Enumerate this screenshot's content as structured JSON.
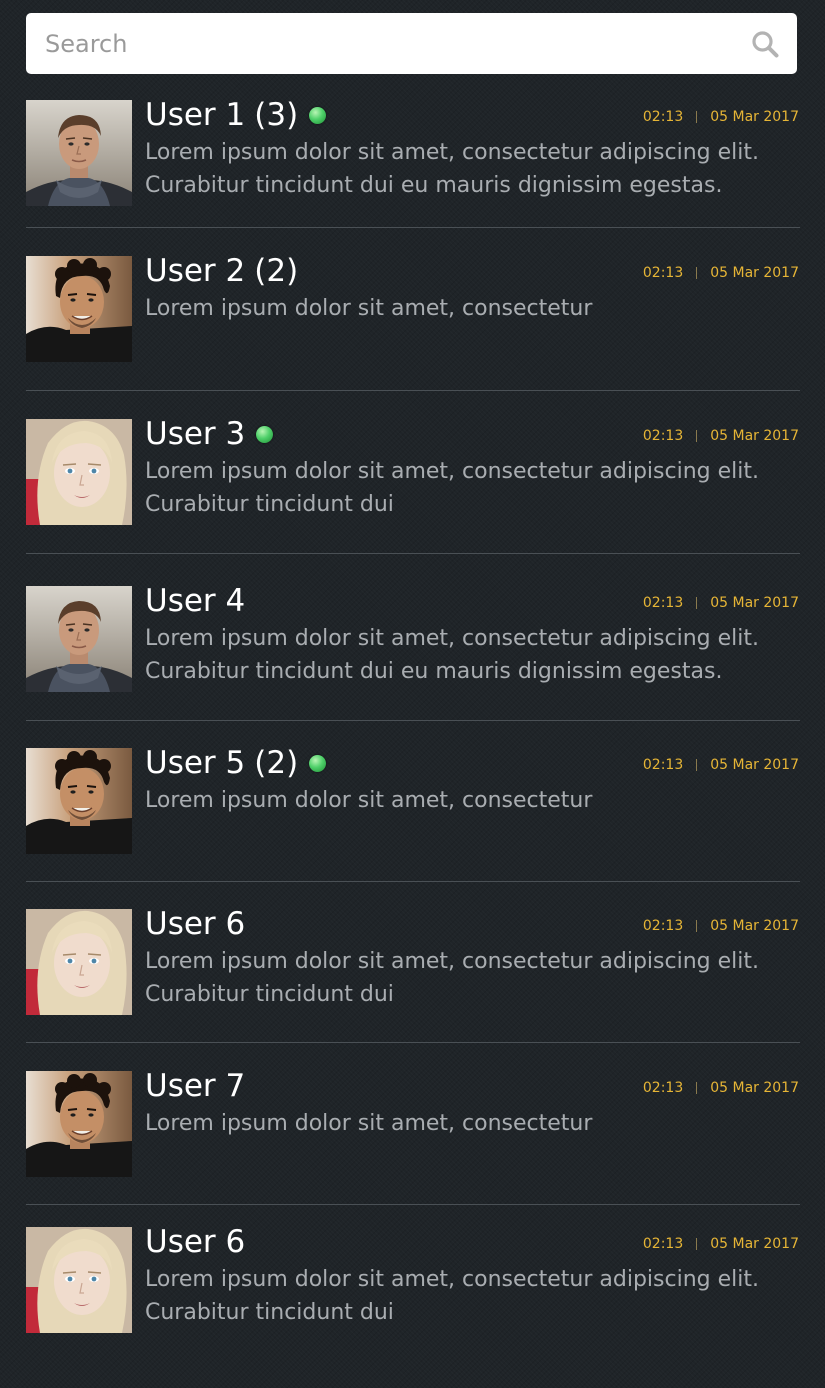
{
  "search": {
    "placeholder": "Search",
    "icon": "search-icon"
  },
  "colors": {
    "background": "#1f2428",
    "name": "#ffffff",
    "preview": "#a9adb1",
    "meta": "#e6b536",
    "divider": "#4a5055",
    "online": "#4fd06a"
  },
  "conversations": [
    {
      "name": "User 1",
      "unread": "(3)",
      "online": true,
      "time": "02:13",
      "date": "05 Mar 2017",
      "avatar": "man-scarf-avatar",
      "preview": [
        "Lorem ipsum dolor sit amet, consectetur adipiscing elit.",
        "Curabitur tincidunt dui eu mauris dignissim egestas."
      ]
    },
    {
      "name": "User 2",
      "unread": "(2)",
      "online": false,
      "time": "02:13",
      "date": "05 Mar 2017",
      "avatar": "man-curly-avatar",
      "preview": [
        "Lorem ipsum dolor sit amet, consectetur"
      ]
    },
    {
      "name": "User 3",
      "unread": "",
      "online": true,
      "time": "02:13",
      "date": "05 Mar 2017",
      "avatar": "woman-blonde-avatar",
      "preview": [
        "Lorem ipsum dolor sit amet, consectetur adipiscing elit.",
        "Curabitur tincidunt dui"
      ]
    },
    {
      "name": "User 4",
      "unread": "",
      "online": false,
      "time": "02:13",
      "date": "05 Mar 2017",
      "avatar": "man-scarf-avatar",
      "preview": [
        "Lorem ipsum dolor sit amet, consectetur adipiscing elit.",
        "Curabitur tincidunt dui eu mauris dignissim egestas."
      ]
    },
    {
      "name": "User 5",
      "unread": "(2)",
      "online": true,
      "time": "02:13",
      "date": "05 Mar 2017",
      "avatar": "man-curly-avatar",
      "preview": [
        "Lorem ipsum dolor sit amet, consectetur"
      ]
    },
    {
      "name": "User 6",
      "unread": "",
      "online": false,
      "time": "02:13",
      "date": "05 Mar 2017",
      "avatar": "woman-blonde-avatar",
      "preview": [
        "Lorem ipsum dolor sit amet, consectetur adipiscing elit.",
        "Curabitur tincidunt dui"
      ]
    },
    {
      "name": "User 7",
      "unread": "",
      "online": false,
      "time": "02:13",
      "date": "05 Mar 2017",
      "avatar": "man-curly-avatar",
      "preview": [
        "Lorem ipsum dolor sit amet, consectetur"
      ]
    },
    {
      "name": "User 6",
      "unread": "",
      "online": false,
      "time": "02:13",
      "date": "05 Mar 2017",
      "avatar": "woman-blonde-avatar",
      "preview": [
        "Lorem ipsum dolor sit amet, consectetur adipiscing elit.",
        "Curabitur tincidunt dui"
      ]
    }
  ]
}
